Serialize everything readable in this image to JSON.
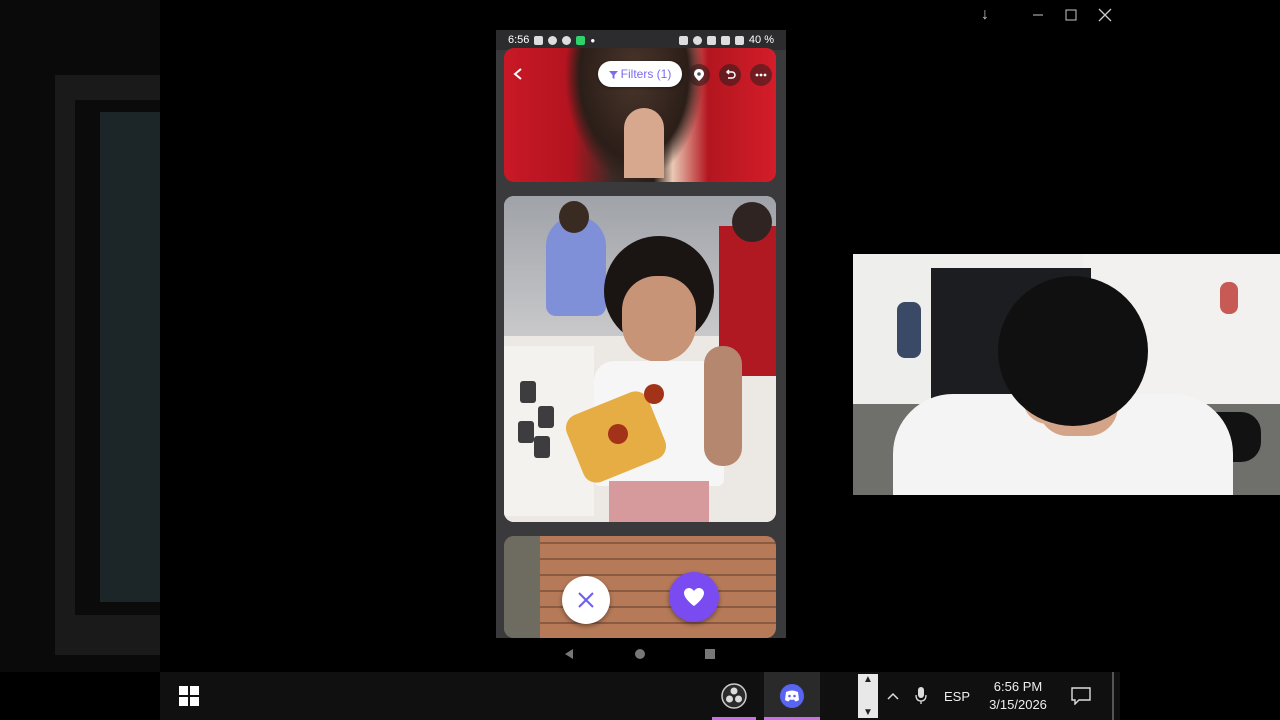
{
  "window": {
    "minimize_icon": "minimize-icon",
    "maximize_icon": "maximize-icon",
    "close_icon": "close-icon",
    "download_arrow": "↓"
  },
  "phone": {
    "status_bar": {
      "time": "6:56",
      "battery": "40 %"
    },
    "toolbar": {
      "back_icon": "chevron-left-icon",
      "filters_label": "Filters (1)",
      "location_icon": "location-pin-icon",
      "undo_icon": "undo-icon",
      "more_icon": "more-icon"
    },
    "actions": {
      "dislike_icon": "close-icon",
      "like_icon": "heart-icon"
    },
    "nav": [
      "back",
      "home",
      "recents"
    ]
  },
  "taskbar": {
    "apps": [
      "windows-start",
      "obs-studio",
      "discord"
    ],
    "language": "ESP",
    "clock_time": "6:56 PM",
    "clock_date": "3/15/2026"
  },
  "colors": {
    "accent_purple": "#7a4bf0",
    "filter_text": "#7a6cf0",
    "taskbar_underline": "#c870e8"
  }
}
